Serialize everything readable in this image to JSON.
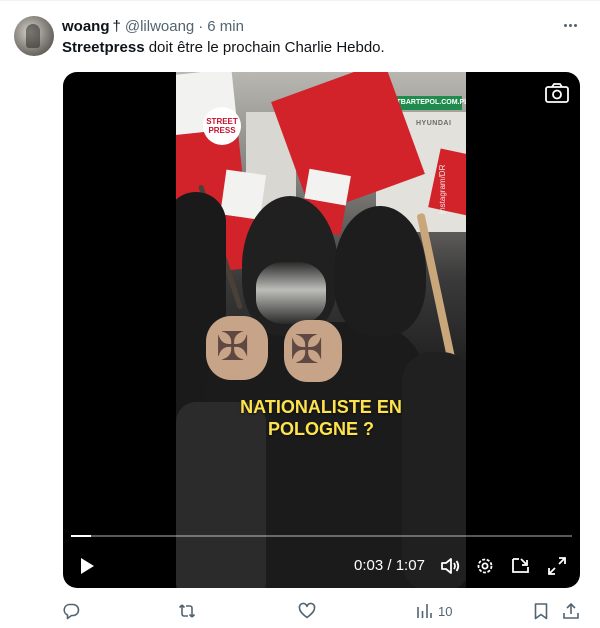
{
  "tweet": {
    "display_name": "woang",
    "name_suffix": "†",
    "handle": "@lilwoang",
    "separator": "·",
    "time": "6 min",
    "text_mention": "Streetpress",
    "text_body": " doit être le prochain Charlie Hebdo."
  },
  "video": {
    "logo_line1": "STREET",
    "logo_line2": "PRESS",
    "credit": "Instagram/DR",
    "sign_text": "HOTBARTEPOL.COM.PL",
    "sign_text2": "HYUNDAI",
    "caption_line1": "NATIONALISTE EN",
    "caption_line2": "POLOGNE ?",
    "time_current": "0:03",
    "time_separator": " / ",
    "time_total": "1:07",
    "progress": 0.04,
    "caption_color": "#ffe34d"
  },
  "actions": {
    "views_count": "10"
  },
  "colors": {
    "text": "#0f1419",
    "secondary": "#536471",
    "flag_red": "#d2232a"
  }
}
